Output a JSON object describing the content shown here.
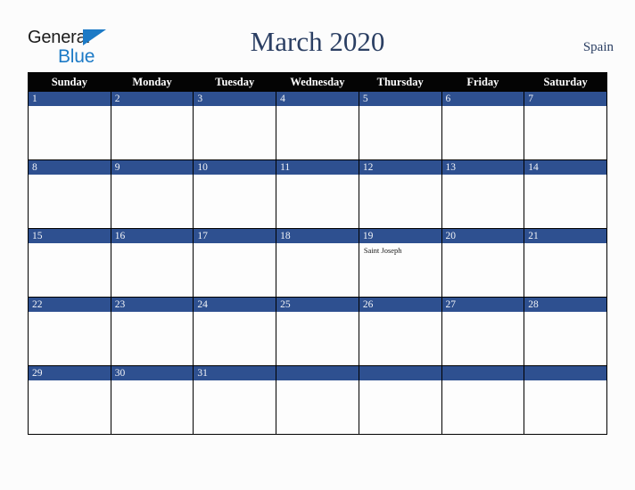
{
  "brand": {
    "name_top": "General",
    "name_bottom": "Blue",
    "triangle_icon": "triangle-icon",
    "color_dark": "#1b1b1b",
    "color_blue": "#1c7ac6"
  },
  "header": {
    "title": "March 2020",
    "country": "Spain",
    "title_color": "#2b3f63"
  },
  "theme": {
    "header_row_bg": "#040404",
    "day_band_bg": "#2e5090",
    "cell_bg": "#fdfdfd",
    "page_bg": "#fcfcfc",
    "grid_line": "#000000"
  },
  "calendar": {
    "weekday_headers": [
      "Sunday",
      "Monday",
      "Tuesday",
      "Wednesday",
      "Thursday",
      "Friday",
      "Saturday"
    ],
    "weeks": [
      [
        {
          "day": "1",
          "events": []
        },
        {
          "day": "2",
          "events": []
        },
        {
          "day": "3",
          "events": []
        },
        {
          "day": "4",
          "events": []
        },
        {
          "day": "5",
          "events": []
        },
        {
          "day": "6",
          "events": []
        },
        {
          "day": "7",
          "events": []
        }
      ],
      [
        {
          "day": "8",
          "events": []
        },
        {
          "day": "9",
          "events": []
        },
        {
          "day": "10",
          "events": []
        },
        {
          "day": "11",
          "events": []
        },
        {
          "day": "12",
          "events": []
        },
        {
          "day": "13",
          "events": []
        },
        {
          "day": "14",
          "events": []
        }
      ],
      [
        {
          "day": "15",
          "events": []
        },
        {
          "day": "16",
          "events": []
        },
        {
          "day": "17",
          "events": []
        },
        {
          "day": "18",
          "events": []
        },
        {
          "day": "19",
          "events": [
            "Saint Joseph"
          ]
        },
        {
          "day": "20",
          "events": []
        },
        {
          "day": "21",
          "events": []
        }
      ],
      [
        {
          "day": "22",
          "events": []
        },
        {
          "day": "23",
          "events": []
        },
        {
          "day": "24",
          "events": []
        },
        {
          "day": "25",
          "events": []
        },
        {
          "day": "26",
          "events": []
        },
        {
          "day": "27",
          "events": []
        },
        {
          "day": "28",
          "events": []
        }
      ],
      [
        {
          "day": "29",
          "events": []
        },
        {
          "day": "30",
          "events": []
        },
        {
          "day": "31",
          "events": []
        },
        {
          "day": "",
          "events": []
        },
        {
          "day": "",
          "events": []
        },
        {
          "day": "",
          "events": []
        },
        {
          "day": "",
          "events": []
        }
      ]
    ]
  }
}
